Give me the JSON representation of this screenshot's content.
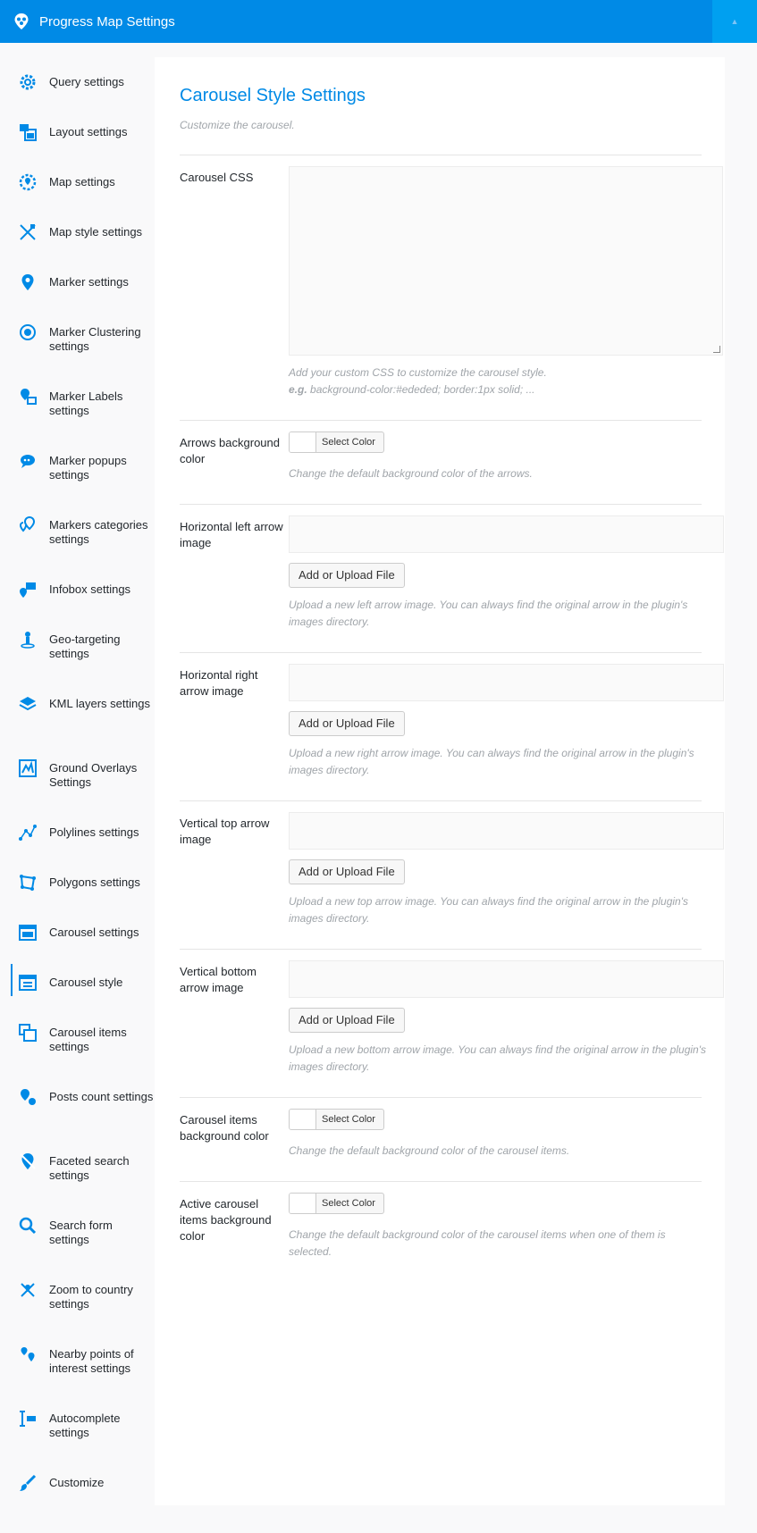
{
  "header": {
    "title": "Progress Map Settings"
  },
  "accent": "#008ae6",
  "sidebar": {
    "items": [
      {
        "label": "Query settings",
        "icon": "gear-icon"
      },
      {
        "label": "Layout settings",
        "icon": "layout-icon"
      },
      {
        "label": "Map settings",
        "icon": "map-gear-icon"
      },
      {
        "label": "Map style settings",
        "icon": "map-style-icon"
      },
      {
        "label": "Marker settings",
        "icon": "marker-icon"
      },
      {
        "label": "Marker Clustering settings",
        "icon": "cluster-icon"
      },
      {
        "label": "Marker Labels settings",
        "icon": "marker-labels-icon"
      },
      {
        "label": "Marker popups settings",
        "icon": "popup-icon"
      },
      {
        "label": "Markers categories settings",
        "icon": "categories-icon"
      },
      {
        "label": "Infobox settings",
        "icon": "infobox-icon"
      },
      {
        "label": "Geo-targeting settings",
        "icon": "geo-icon"
      },
      {
        "label": "KML layers settings",
        "icon": "layers-icon"
      },
      {
        "label": "Ground Overlays Settings",
        "icon": "overlay-icon"
      },
      {
        "label": "Polylines settings",
        "icon": "polyline-icon"
      },
      {
        "label": "Polygons settings",
        "icon": "polygon-icon"
      },
      {
        "label": "Carousel settings",
        "icon": "carousel-icon"
      },
      {
        "label": "Carousel style",
        "icon": "carousel-style-icon"
      },
      {
        "label": "Carousel items settings",
        "icon": "carousel-items-icon"
      },
      {
        "label": "Posts count settings",
        "icon": "posts-count-icon"
      },
      {
        "label": "Faceted search settings",
        "icon": "faceted-search-icon"
      },
      {
        "label": "Search form settings",
        "icon": "search-icon"
      },
      {
        "label": "Zoom to country settings",
        "icon": "zoom-country-icon"
      },
      {
        "label": "Nearby points of interest settings",
        "icon": "nearby-icon"
      },
      {
        "label": "Autocomplete settings",
        "icon": "autocomplete-icon"
      },
      {
        "label": "Customize",
        "icon": "brush-icon"
      }
    ]
  },
  "main": {
    "title": "Carousel Style Settings",
    "subtitle": "Customize the carousel.",
    "carousel_css": {
      "label": "Carousel CSS",
      "desc": "Add your custom CSS to customize the carousel style.",
      "example_label": "e.g.",
      "example": "background-color:#ededed; border:1px solid; ..."
    },
    "arrows_bg": {
      "label": "Arrows background color",
      "button": "Select Color",
      "desc": "Change the default background color of the arrows."
    },
    "left_arrow": {
      "label": "Horizontal left arrow image",
      "button": "Add or Upload File",
      "desc": "Upload a new left arrow image. You can always find the original arrow in the plugin's images directory."
    },
    "right_arrow": {
      "label": "Horizontal right arrow image",
      "button": "Add or Upload File",
      "desc": "Upload a new right arrow image. You can always find the original arrow in the plugin's images directory."
    },
    "top_arrow": {
      "label": "Vertical top arrow image",
      "button": "Add or Upload File",
      "desc": "Upload a new top arrow image. You can always find the original arrow in the plugin's images directory."
    },
    "bottom_arrow": {
      "label": "Vertical bottom arrow image",
      "button": "Add or Upload File",
      "desc": "Upload a new bottom arrow image. You can always find the original arrow in the plugin's images directory."
    },
    "items_bg": {
      "label": "Carousel items background color",
      "button": "Select Color",
      "desc": "Change the default background color of the carousel items."
    },
    "active_items_bg": {
      "label": "Active carousel items background color",
      "button": "Select Color",
      "desc": "Change the default background color of the carousel items when one of them is selected."
    }
  }
}
